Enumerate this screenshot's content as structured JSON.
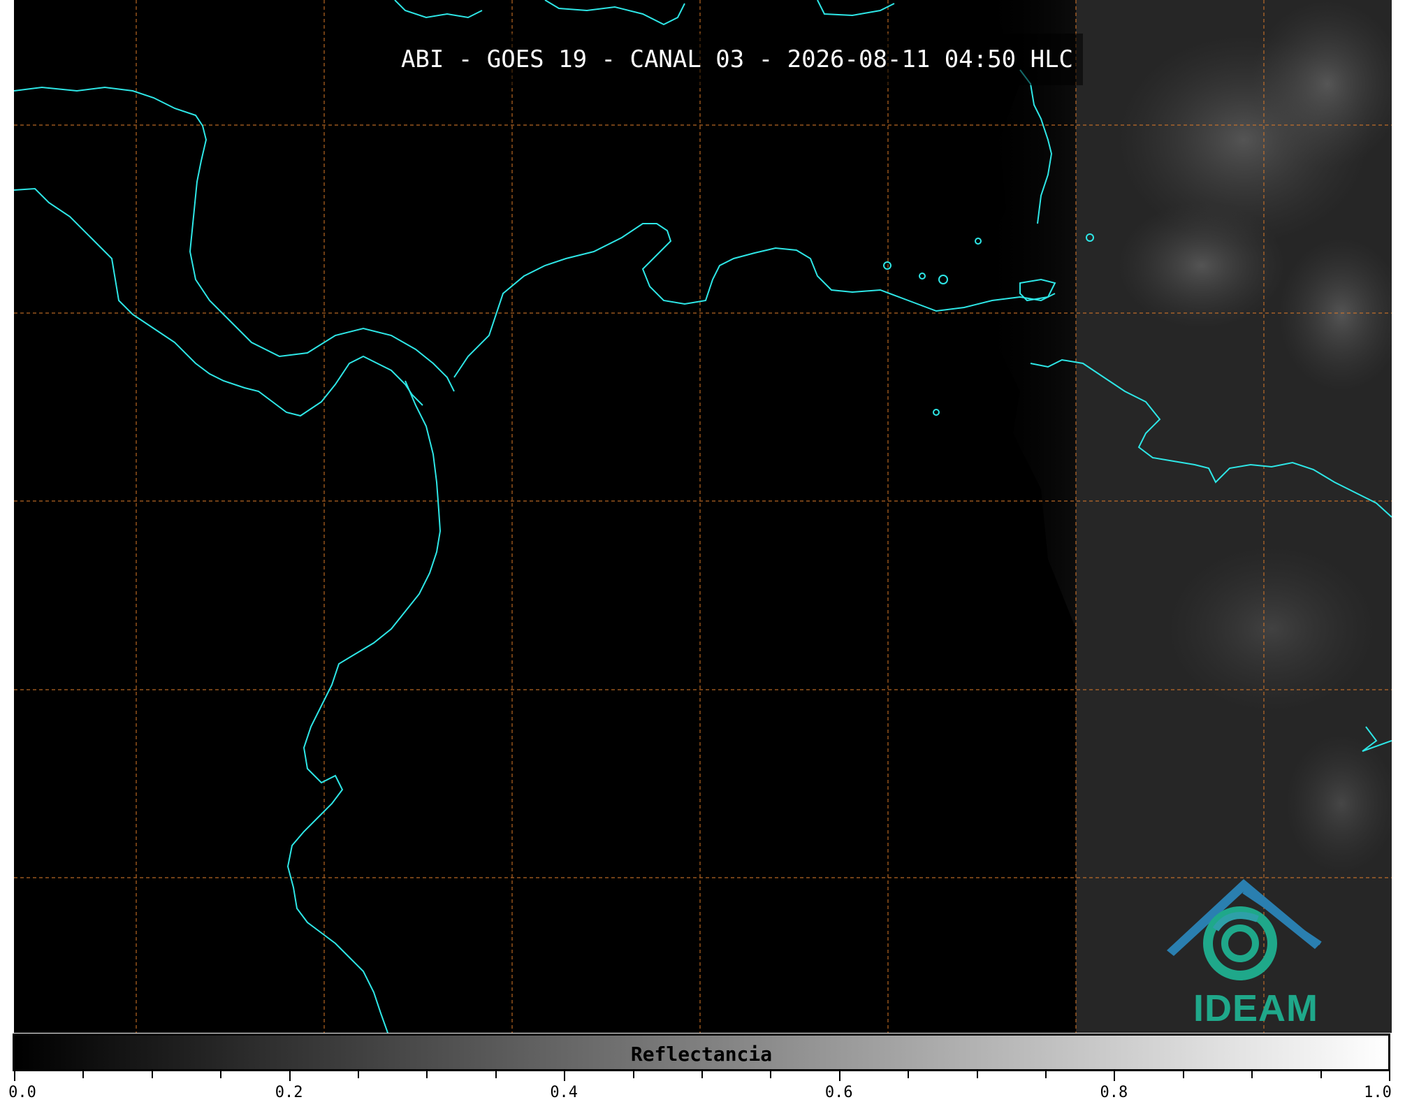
{
  "map": {
    "title": "ABI - GOES 19 - CANAL 03 - 2026-08-11 04:50 HLC",
    "colors": {
      "background": "#000000",
      "coastline": "#2ee6e6",
      "graticule": "#d8782a",
      "cloud_gray": "#3a3a3a"
    }
  },
  "logo": {
    "text": "IDEAM",
    "icon": "ideam-logo-icon"
  },
  "colorbar": {
    "label": "Reflectancia",
    "min": 0.0,
    "max": 1.0,
    "tick_labels": [
      "0.0",
      "0.2",
      "0.4",
      "0.6",
      "0.8",
      "1.0"
    ]
  }
}
